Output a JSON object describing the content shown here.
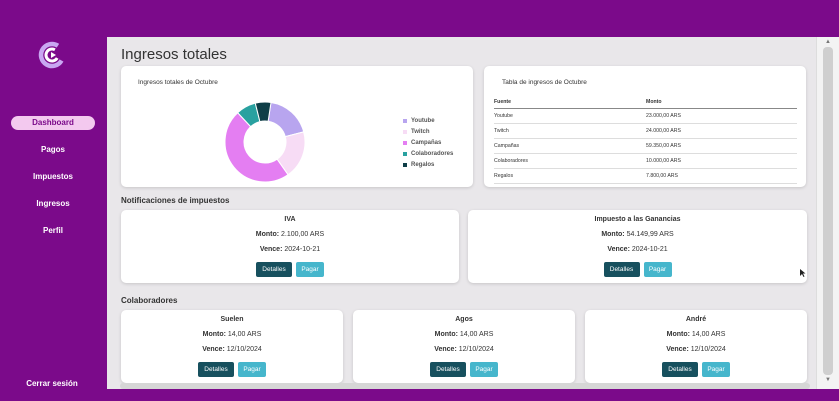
{
  "sidebar": {
    "items": [
      {
        "label": "Dashboard",
        "active": true
      },
      {
        "label": "Pagos",
        "active": false
      },
      {
        "label": "Impuestos",
        "active": false
      },
      {
        "label": "Ingresos",
        "active": false
      },
      {
        "label": "Perfil",
        "active": false
      }
    ],
    "logout": "Cerrar sesión"
  },
  "page": {
    "title": "Ingresos totales"
  },
  "chart_card": {
    "title": "Ingresos totales de Octubre"
  },
  "chart_data": {
    "type": "pie",
    "title": "Ingresos totales de Octubre",
    "categories": [
      "Youtube",
      "Twitch",
      "Campañas",
      "Colaboradores",
      "Regalos"
    ],
    "values": [
      23000,
      24000,
      59350,
      10000,
      7800
    ],
    "colors": [
      "#b8a5ef",
      "#f7dcf5",
      "#e47ef2",
      "#29a1a0",
      "#0e3e47"
    ],
    "legend": "right"
  },
  "table_card": {
    "title": "Tabla de ingresos de Octubre",
    "headers": [
      "Fuente",
      "Monto"
    ],
    "rows": [
      [
        "Youtube",
        "23.000,00 ARS"
      ],
      [
        "Twitch",
        "24.000,00 ARS"
      ],
      [
        "Campañas",
        "59.350,00 ARS"
      ],
      [
        "Colaboradores",
        "10.000,00 ARS"
      ],
      [
        "Regalos",
        "7.800,00 ARS"
      ]
    ]
  },
  "taxes": {
    "section_title": "Notificaciones de impuestos",
    "items": [
      {
        "name": "IVA",
        "monto_label": "Monto:",
        "monto": "2.100,00 ARS",
        "vence_label": "Vence:",
        "vence": "2024-10-21",
        "details": "Detalles",
        "pay": "Pagar"
      },
      {
        "name": "Impuesto a las Ganancias",
        "monto_label": "Monto:",
        "monto": "54.149,99 ARS",
        "vence_label": "Vence:",
        "vence": "2024-10-21",
        "details": "Detalles",
        "pay": "Pagar"
      }
    ]
  },
  "collaborators": {
    "section_title": "Colaboradores",
    "items": [
      {
        "name": "Suelen",
        "monto_label": "Monto:",
        "monto": "14,00 ARS",
        "vence_label": "Vence:",
        "vence": "12/10/2024",
        "details": "Detalles",
        "pay": "Pagar"
      },
      {
        "name": "Agos",
        "monto_label": "Monto:",
        "monto": "14,00 ARS",
        "vence_label": "Vence:",
        "vence": "12/10/2024",
        "details": "Detalles",
        "pay": "Pagar"
      },
      {
        "name": "André",
        "monto_label": "Monto:",
        "monto": "14,00 ARS",
        "vence_label": "Vence:",
        "vence": "12/10/2024",
        "details": "Detalles",
        "pay": "Pagar"
      }
    ]
  }
}
